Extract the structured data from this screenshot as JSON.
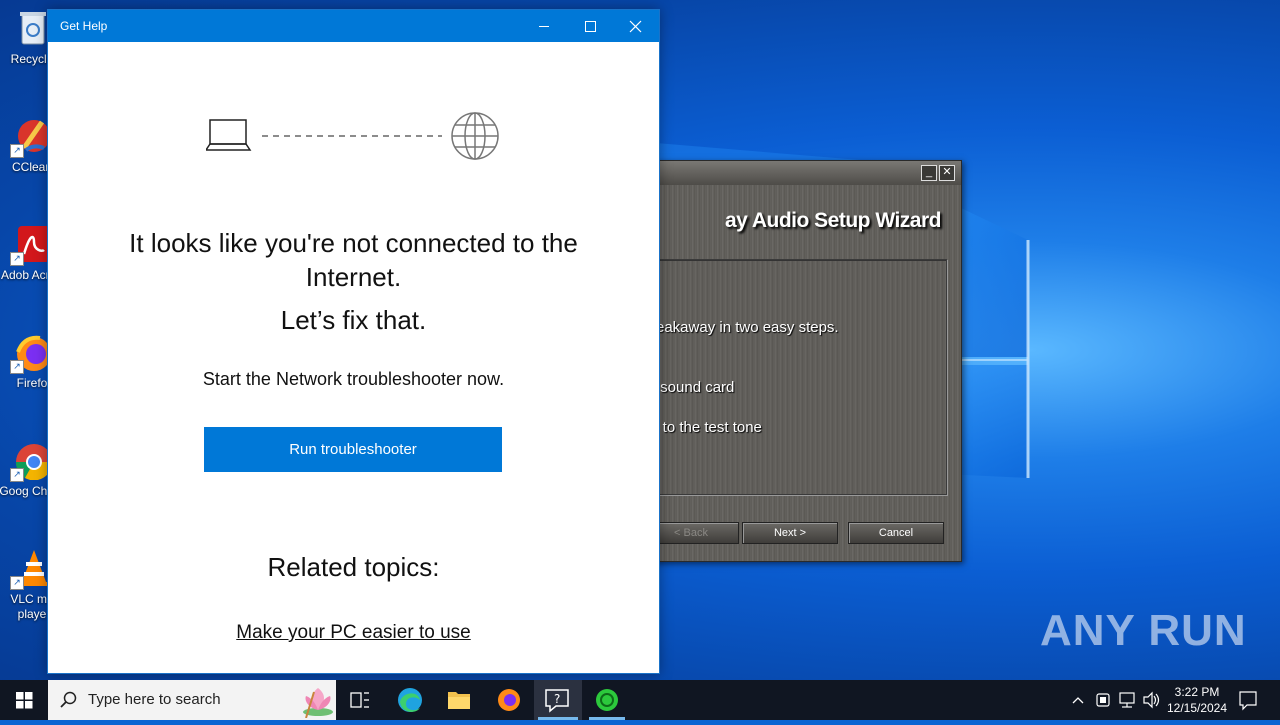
{
  "desktop": {
    "icons": [
      {
        "label": "Recycle"
      },
      {
        "label": "CClean"
      },
      {
        "label": "Adob Acrob"
      },
      {
        "label": "Firefo"
      },
      {
        "label": "Goog Chron"
      },
      {
        "label": "VLC me playe"
      }
    ],
    "watermark": "ANY RUN"
  },
  "wizard": {
    "heading": "ay Audio Setup Wizard",
    "lines": [
      "reakaway in two easy steps.",
      "r sound card",
      "y to the test tone"
    ],
    "buttons": {
      "back": "< Back",
      "next": "Next >",
      "cancel": "Cancel"
    },
    "title_controls": {
      "minimize": "_",
      "close": "✕"
    }
  },
  "gethelp": {
    "title": "Get Help",
    "heading": "It looks like you're not connected to the Internet.",
    "subheading": "Let’s fix that.",
    "description": "Start the Network troubleshooter now.",
    "run_button": "Run troubleshooter",
    "related_title": "Related topics:",
    "related_link": "Make your PC easier to use"
  },
  "taskbar": {
    "search_placeholder": "Type here to search",
    "time": "3:22 PM",
    "date": "12/15/2024"
  },
  "colors": {
    "accent": "#0078d7",
    "taskbar": "#101622"
  }
}
